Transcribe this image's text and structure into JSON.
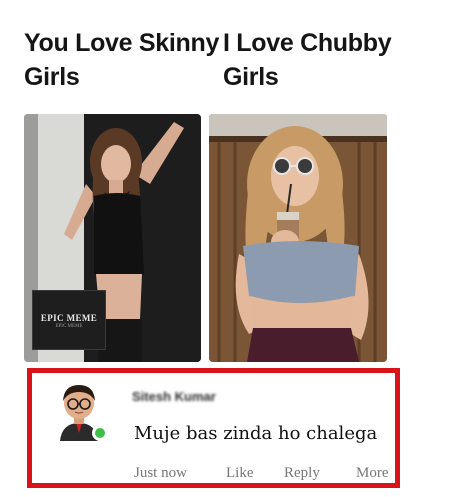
{
  "meme": {
    "left_caption": "You Love Skinny Girls",
    "right_caption": "I Love Chubby Girls",
    "watermark": {
      "title": "EPIC MEME",
      "subtitle": "EPIC MEME"
    }
  },
  "comment": {
    "commenter_name": "Sitesh Kumar",
    "text": "Muje bas zinda ho chalega",
    "actions": {
      "time": "Just now",
      "like": "Like",
      "reply": "Reply",
      "more": "More"
    },
    "online_status_color": "#3cc04a",
    "highlight_border_color": "#d8141a"
  },
  "icons": {
    "avatar": "bitmoji-avatar-icon",
    "online": "online-status-dot-icon"
  }
}
